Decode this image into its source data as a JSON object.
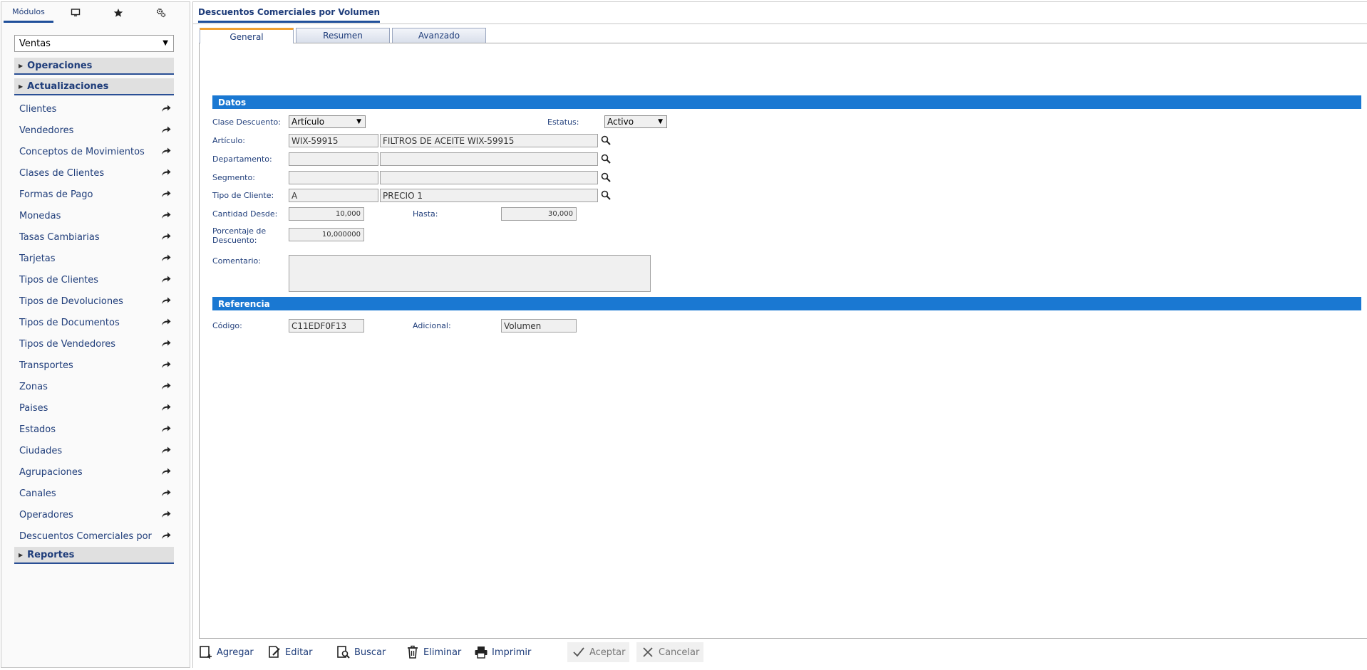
{
  "sidebar": {
    "tabs": {
      "modulos": "Módulos",
      "screen_icon": "monitor-icon",
      "fav_icon": "star-icon",
      "cfg_icon": "gears-icon"
    },
    "module_select": "Ventas",
    "sections": {
      "operaciones": "Operaciones",
      "actualizaciones": "Actualizaciones",
      "reportes": "Reportes"
    },
    "items": [
      "Clientes",
      "Vendedores",
      "Conceptos de Movimientos",
      "Clases de Clientes",
      "Formas de Pago",
      "Monedas",
      "Tasas Cambiarias",
      "Tarjetas",
      "Tipos de Clientes",
      "Tipos de Devoluciones",
      "Tipos de Documentos",
      "Tipos de Vendedores",
      "Transportes",
      "Zonas",
      "Paises",
      "Estados",
      "Ciudades",
      "Agrupaciones",
      "Canales",
      "Operadores",
      "Descuentos Comerciales por Volumen"
    ]
  },
  "main": {
    "title": "Descuentos Comerciales por Volumen",
    "tabs": {
      "general": "General",
      "resumen": "Resumen",
      "avanzado": "Avanzado"
    },
    "bands": {
      "datos": "Datos",
      "referencia": "Referencia"
    },
    "fields": {
      "clase_descuento": {
        "label": "Clase Descuento:",
        "value": "Artículo"
      },
      "estatus": {
        "label": "Estatus:",
        "value": "Activo"
      },
      "articulo": {
        "label": "Artículo:",
        "code": "WIX-59915",
        "desc": "FILTROS DE ACEITE WIX-59915"
      },
      "departamento": {
        "label": "Departamento:",
        "code": "",
        "desc": ""
      },
      "segmento": {
        "label": "Segmento:",
        "code": "",
        "desc": ""
      },
      "tipo_cliente": {
        "label": "Tipo de Cliente:",
        "code": "A",
        "desc": "PRECIO 1"
      },
      "cantidad_desde": {
        "label": "Cantidad Desde:",
        "value": "10,000"
      },
      "hasta": {
        "label": "Hasta:",
        "value": "30,000"
      },
      "porcentaje": {
        "label_line1": "Porcentaje de",
        "label_line2": "Descuento:",
        "value": "10,000000"
      },
      "comentario": {
        "label": "Comentario:",
        "value": ""
      },
      "codigo": {
        "label": "Código:",
        "value": "C11EDF0F13"
      },
      "adicional": {
        "label": "Adicional:",
        "value": "Volumen"
      }
    }
  },
  "toolbar": {
    "agregar": "Agregar",
    "editar": "Editar",
    "buscar": "Buscar",
    "eliminar": "Eliminar",
    "imprimir": "Imprimir",
    "aceptar": "Aceptar",
    "cancelar": "Cancelar"
  }
}
